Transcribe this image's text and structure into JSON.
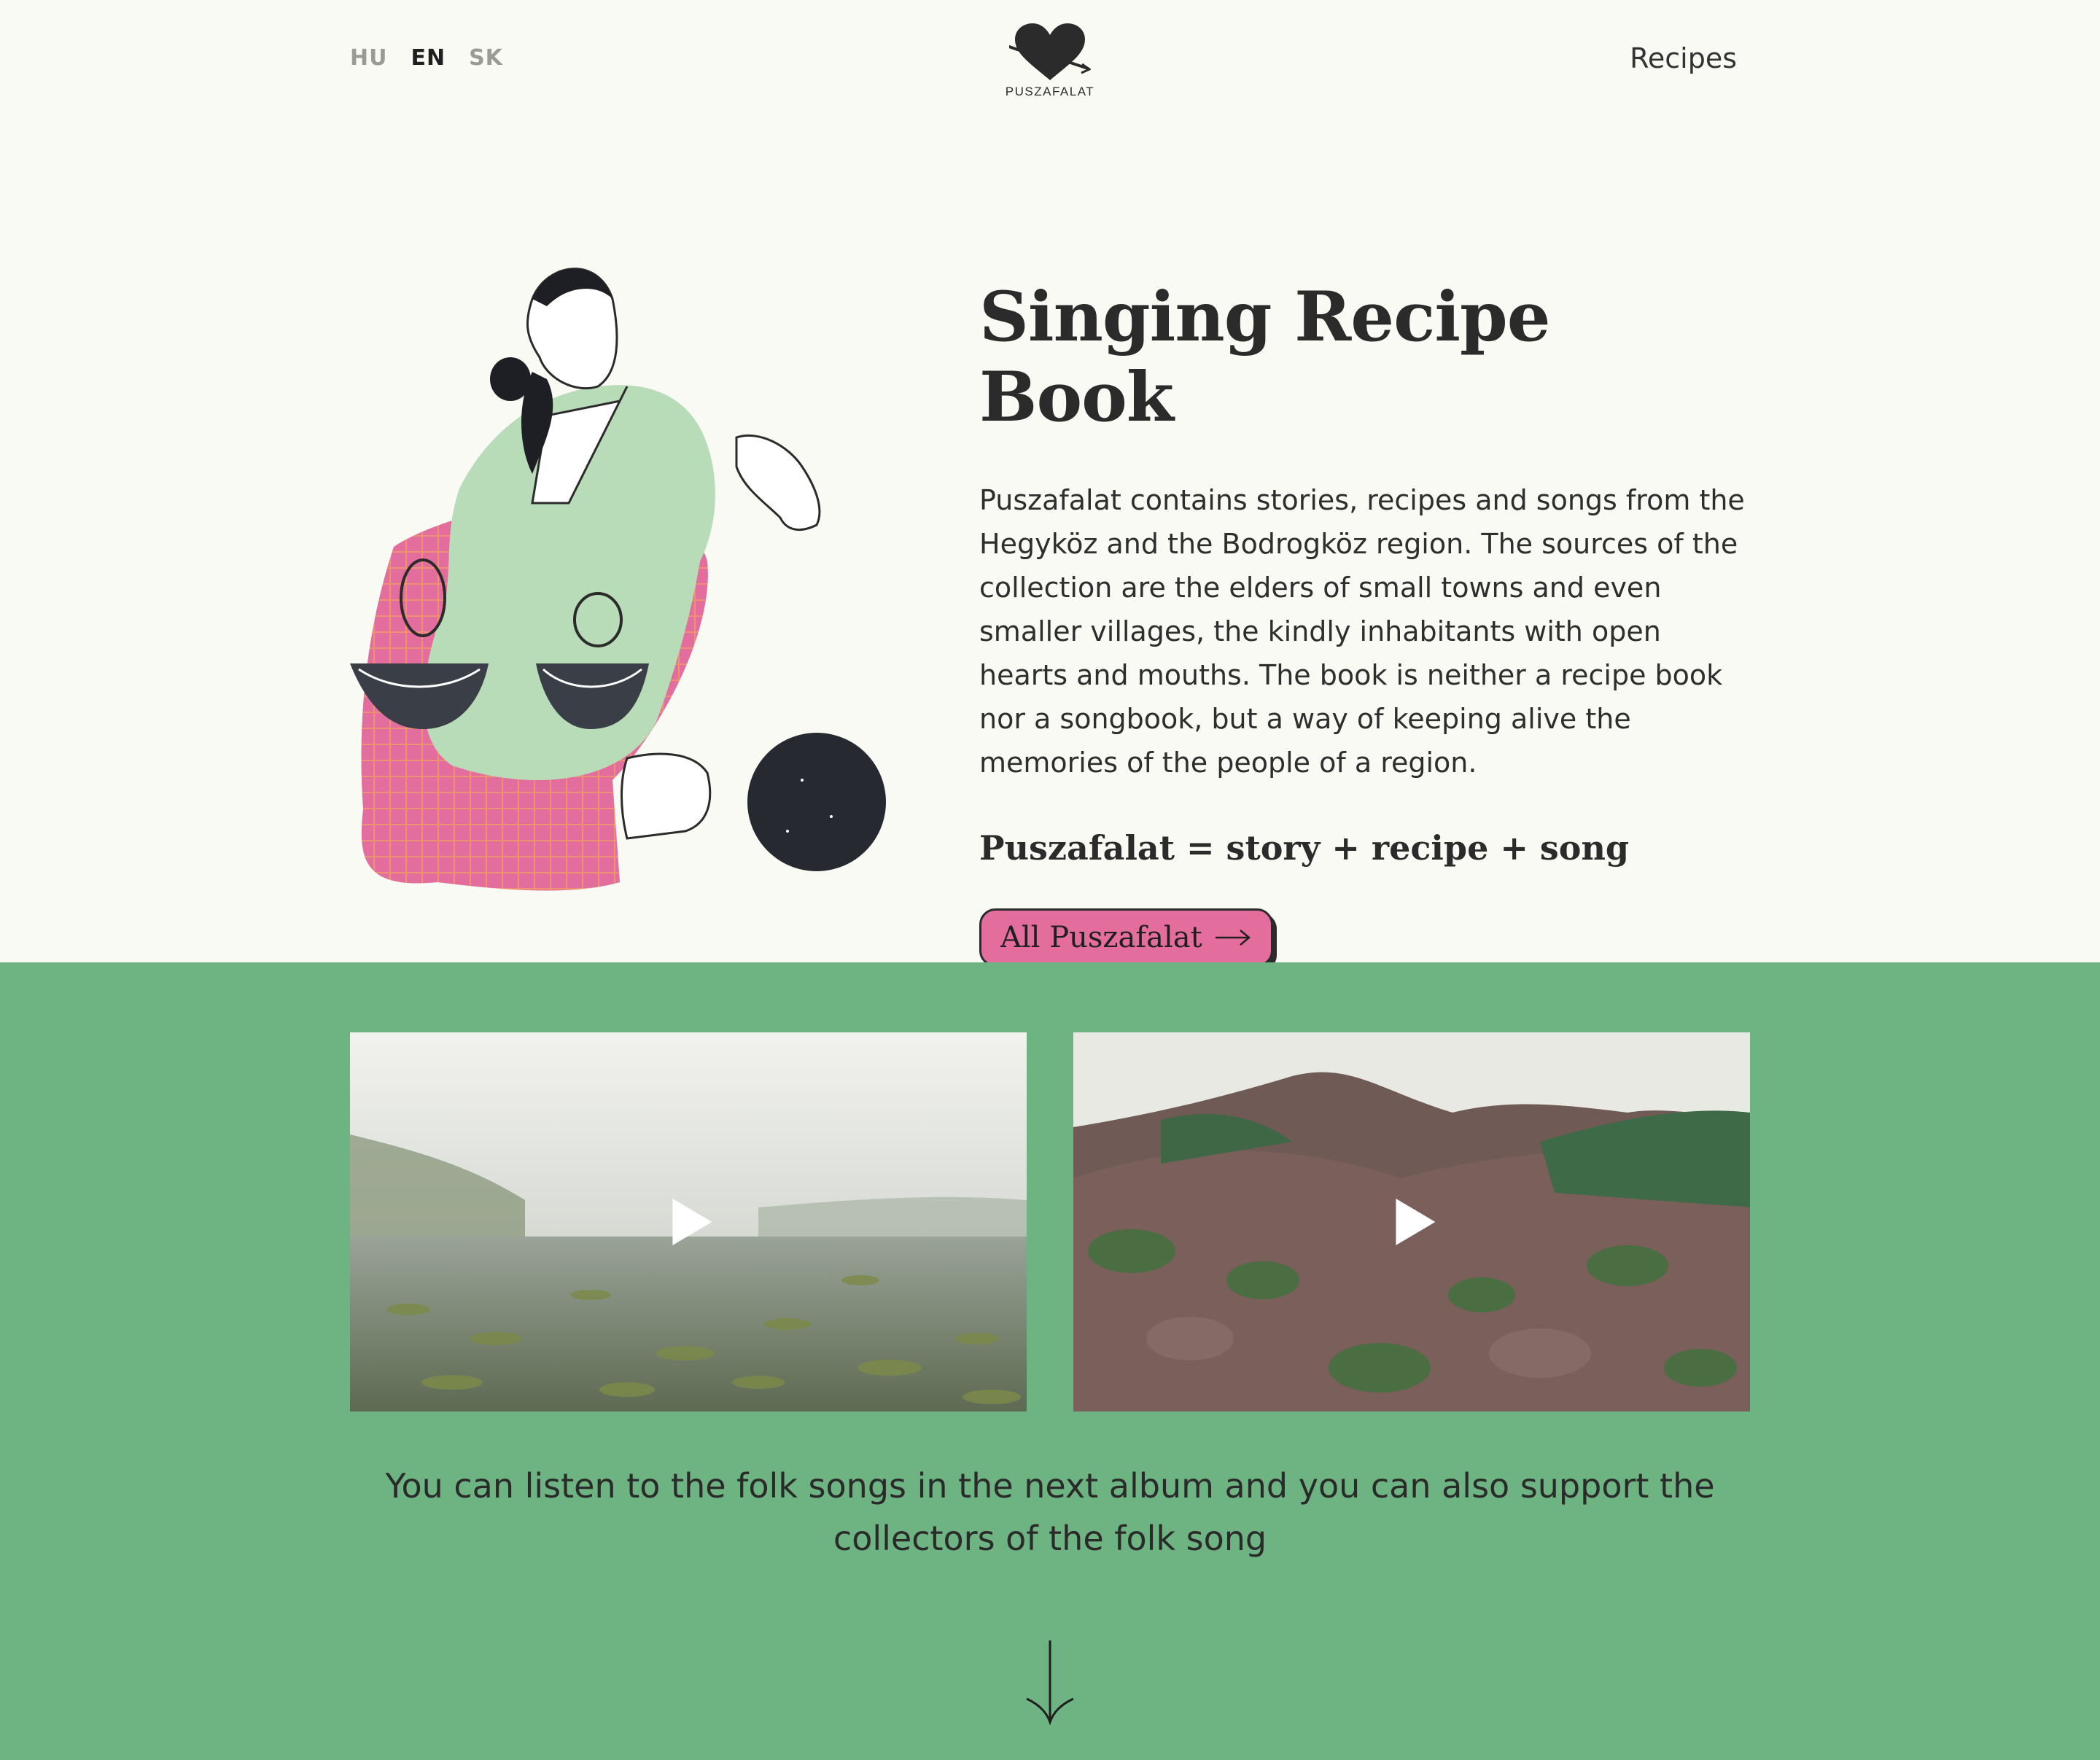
{
  "header": {
    "languages": [
      {
        "code": "HU",
        "active": false
      },
      {
        "code": "EN",
        "active": true
      },
      {
        "code": "SK",
        "active": false
      }
    ],
    "logo_text": "PUSZAFALAT",
    "nav_recipes": "Recipes"
  },
  "hero": {
    "title": "Singing Recipe Book",
    "description": "Puszafalat contains stories, recipes and songs from the Hegyköz and the Bodrogköz region. The sources of the collection are the elders of small towns and even smaller villages, the kindly inhabitants with open hearts and mouths. The book is neither a recipe book nor a songbook, but a way of keeping alive the memories of the people of a region.",
    "formula": "Puszafalat = story + recipe + song",
    "cta_label": "All Puszafalat"
  },
  "media": {
    "videos": [
      {
        "scene": "misty lake with water lilies"
      },
      {
        "scene": "forested autumn hills"
      }
    ],
    "caption": "You can listen to the folk songs in the next album and you can also support the collectors of the folk song"
  },
  "colors": {
    "page_bg": "#fafaf4",
    "green_section": "#6db482",
    "cta_pink": "#e36e9d",
    "illustration_green": "#b9dcb8",
    "illustration_pink": "#e36e9d",
    "text_dark": "#2b2b2b"
  }
}
